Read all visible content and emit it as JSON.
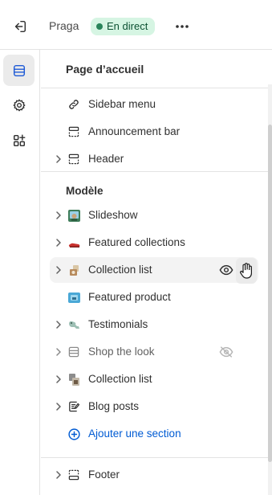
{
  "topbar": {
    "theme_name": "Praga",
    "live_badge": "En direct"
  },
  "panel": {
    "title": "Page d’accueil",
    "header_items": [
      {
        "label": "Sidebar menu",
        "icon": "link-icon",
        "expandable": false
      },
      {
        "label": "Announcement bar",
        "icon": "section-icon",
        "expandable": false
      },
      {
        "label": "Header",
        "icon": "section-icon",
        "expandable": true
      }
    ],
    "template_title": "Modèle",
    "template_items": [
      {
        "label": "Slideshow",
        "icon": "slideshow-thumbnail",
        "expandable": true,
        "hidden": false
      },
      {
        "label": "Featured collections",
        "icon": "shoes-thumbnail",
        "expandable": true,
        "hidden": false
      },
      {
        "label": "Collection list",
        "icon": "collection-thumbnail",
        "expandable": true,
        "hidden": false
      },
      {
        "label": "Featured product",
        "icon": "product-thumbnail",
        "expandable": false,
        "hidden": false
      },
      {
        "label": "Testimonials",
        "icon": "testimonial-thumbnail",
        "expandable": true,
        "hidden": false
      },
      {
        "label": "Shop the look",
        "icon": "section-icon",
        "expandable": true,
        "hidden": true
      },
      {
        "label": "Collection list",
        "icon": "collection-thumbnail",
        "expandable": true,
        "hidden": false
      },
      {
        "label": "Blog posts",
        "icon": "blog-icon",
        "expandable": true,
        "hidden": false
      }
    ],
    "add_section": "Ajouter une section",
    "footer_item": {
      "label": "Footer",
      "icon": "section-icon",
      "expandable": true
    }
  },
  "colors": {
    "live_badge_bg": "#d6f5e3",
    "live_dot": "#29845a",
    "link_blue": "#005bd3",
    "active_rail_bg": "#ebebeb"
  }
}
